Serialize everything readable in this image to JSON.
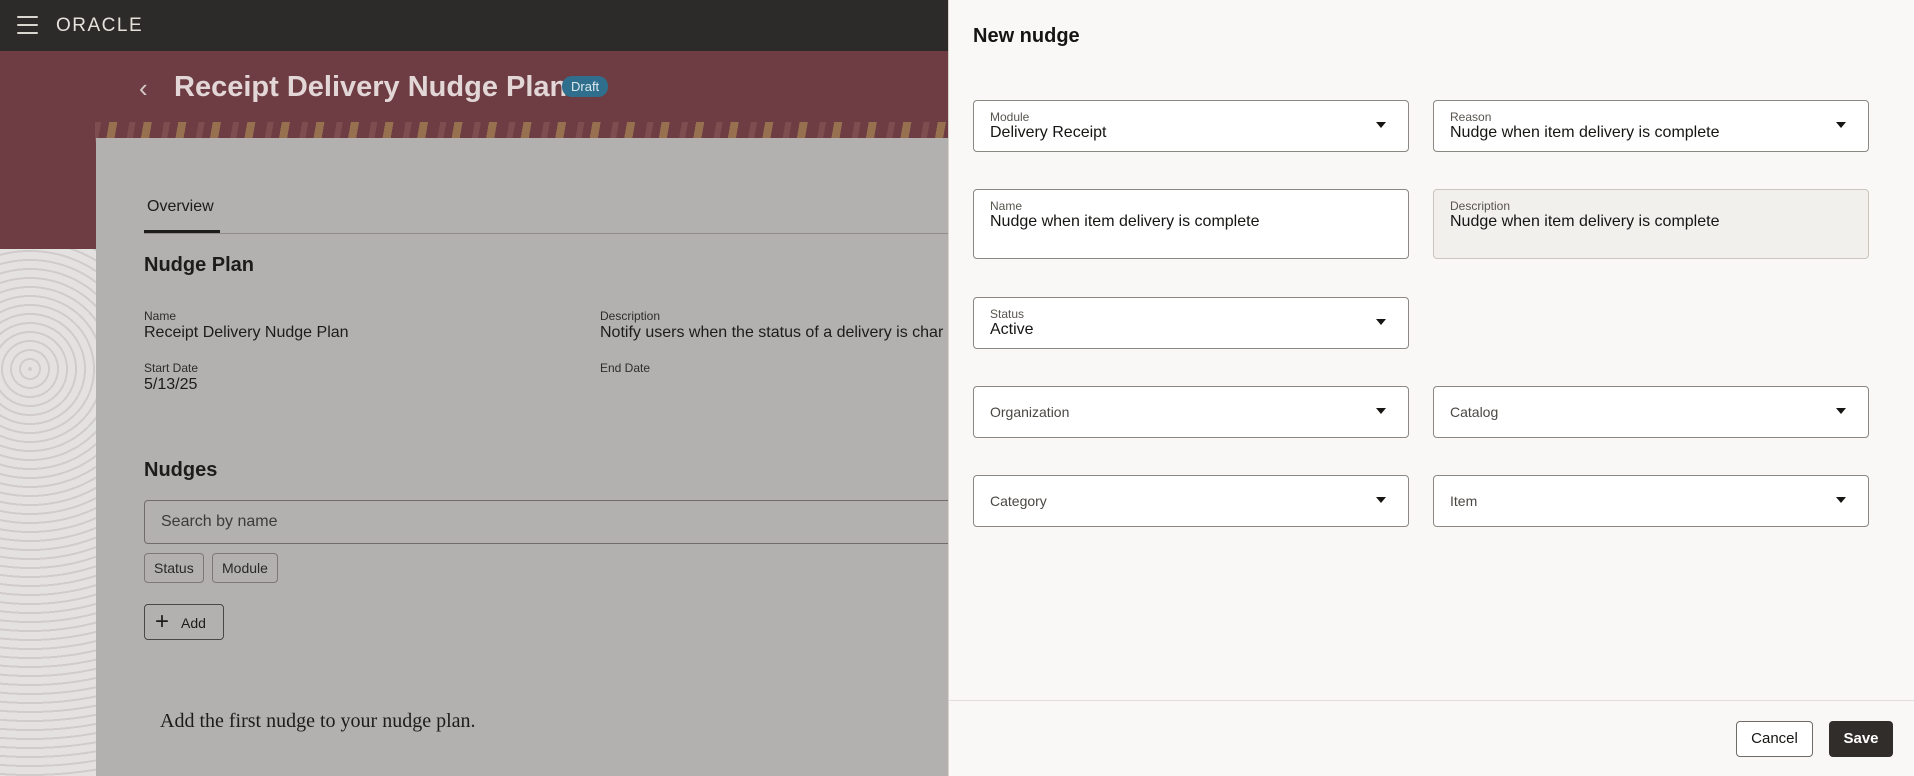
{
  "app": {
    "logo_text": "ORACLE"
  },
  "page": {
    "title": "Receipt Delivery Nudge Plan",
    "badge": "Draft",
    "tabs": [
      {
        "label": "Overview"
      }
    ],
    "nudge_plan": {
      "heading": "Nudge Plan",
      "name_label": "Name",
      "name_value": "Receipt Delivery Nudge Plan",
      "description_label": "Description",
      "description_value": "Notify users when the status of a delivery is char",
      "start_date_label": "Start Date",
      "start_date_value": "5/13/25",
      "end_date_label": "End Date"
    },
    "nudges": {
      "heading": "Nudges",
      "search_placeholder": "Search by name",
      "filters": [
        "Status",
        "Module"
      ],
      "add_label": "Add",
      "empty_message": "Add the first nudge to your nudge plan."
    }
  },
  "drawer": {
    "title": "New nudge",
    "fields": {
      "module": {
        "label": "Module",
        "value": "Delivery Receipt"
      },
      "reason": {
        "label": "Reason",
        "value": "Nudge when item delivery is complete"
      },
      "name": {
        "label": "Name",
        "value": "Nudge when item delivery is complete"
      },
      "description": {
        "label": "Description",
        "value": "Nudge when item delivery is complete"
      },
      "status": {
        "label": "Status",
        "value": "Active"
      },
      "organization": {
        "label": "Organization"
      },
      "catalog": {
        "label": "Catalog"
      },
      "category": {
        "label": "Category"
      },
      "item": {
        "label": "Item"
      }
    },
    "cancel_label": "Cancel",
    "save_label": "Save"
  }
}
